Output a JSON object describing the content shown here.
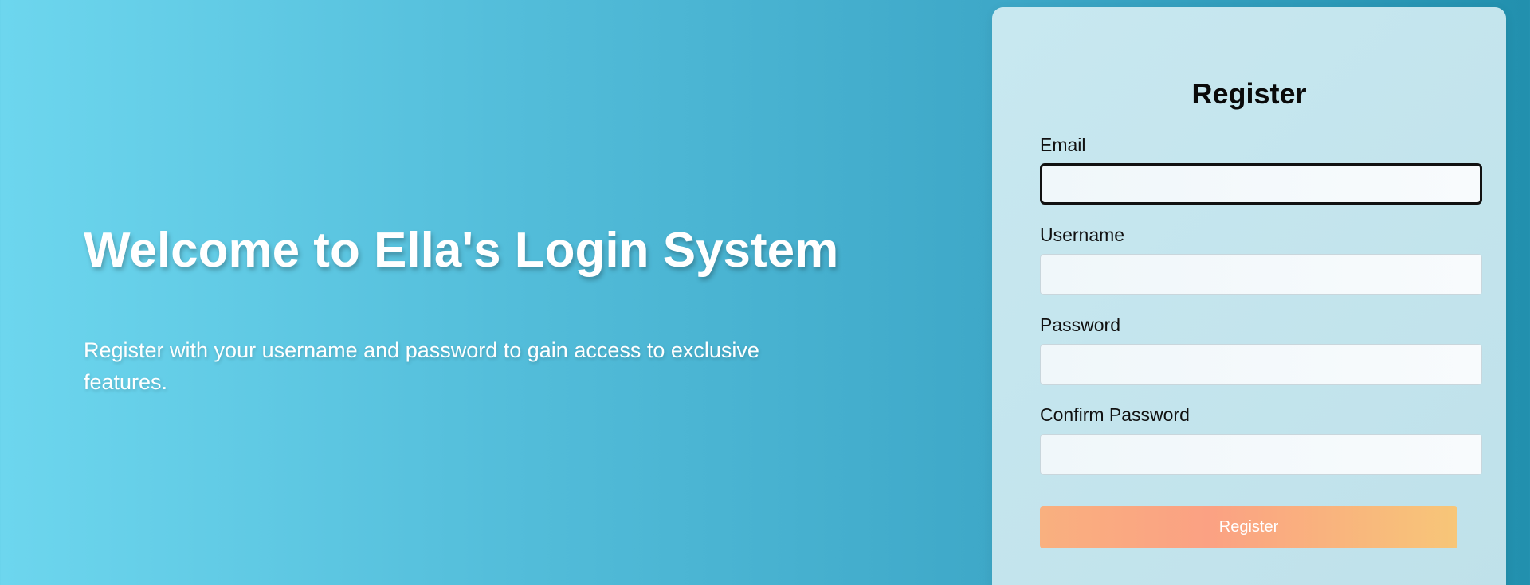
{
  "hero": {
    "title": "Welcome to Ella's Login System",
    "subtitle": "Register with your username and password to gain access to exclusive features."
  },
  "form": {
    "title": "Register",
    "fields": [
      {
        "label": "Email",
        "value": "",
        "focused": true
      },
      {
        "label": "Username",
        "value": ""
      },
      {
        "label": "Password",
        "value": ""
      },
      {
        "label": "Confirm Password",
        "value": ""
      }
    ],
    "submit_label": "Register"
  },
  "colors": {
    "background_start": "#6dd6ee",
    "background_end": "#2290ae",
    "card": "#c5e5ee",
    "button_start": "#f9b07f",
    "button_end": "#f7c678"
  }
}
